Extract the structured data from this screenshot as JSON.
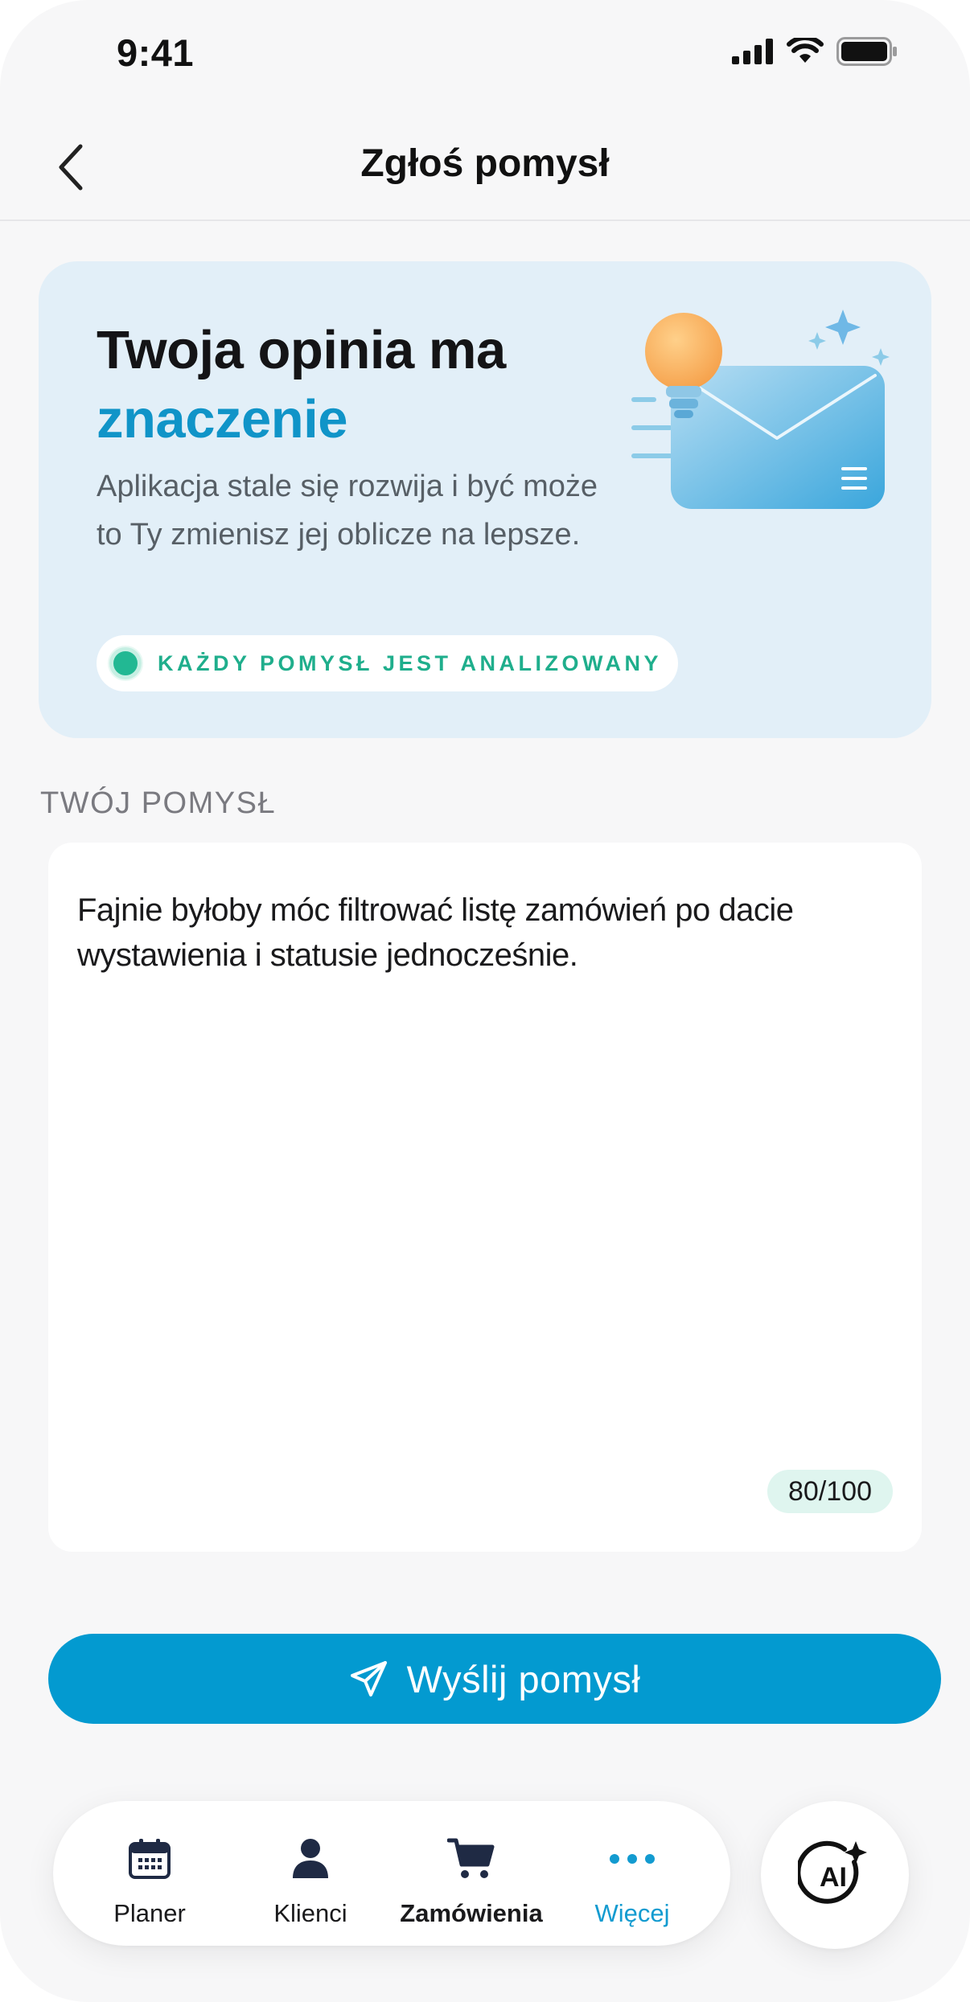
{
  "status_bar": {
    "time": "9:41"
  },
  "header": {
    "title": "Zgłoś pomysł"
  },
  "hero": {
    "title_line1": "Twoja opinia ma",
    "title_line2": "znaczenie",
    "description": "Aplikacja stale się rozwija i być może to Ty zmienisz jej oblicze na lepsze.",
    "badge": "KAŻDY POMYSŁ JEST ANALIZOWANY"
  },
  "form": {
    "section_label": "TWÓJ POMYSŁ",
    "idea_value": "Fajnie byłoby móc filtrować listę zamówień po dacie wystawienia i statusie jednocześnie.",
    "char_counter": "80/100",
    "submit_label": "Wyślij pomysł"
  },
  "tabbar": {
    "items": [
      {
        "label": "Planer",
        "icon": "calendar-icon"
      },
      {
        "label": "Klienci",
        "icon": "person-icon"
      },
      {
        "label": "Zamówienia",
        "icon": "cart-icon"
      },
      {
        "label": "Więcej",
        "icon": "more-dots-icon",
        "active": true
      }
    ],
    "ai_button": {
      "label": "AI",
      "icon": "ai-sparkle-icon"
    }
  },
  "colors": {
    "accent": "#039ad0",
    "accent_text": "#1094c8",
    "hero_background": "#e2eff8",
    "success": "#22b893",
    "page_background": "#f7f7f8"
  }
}
